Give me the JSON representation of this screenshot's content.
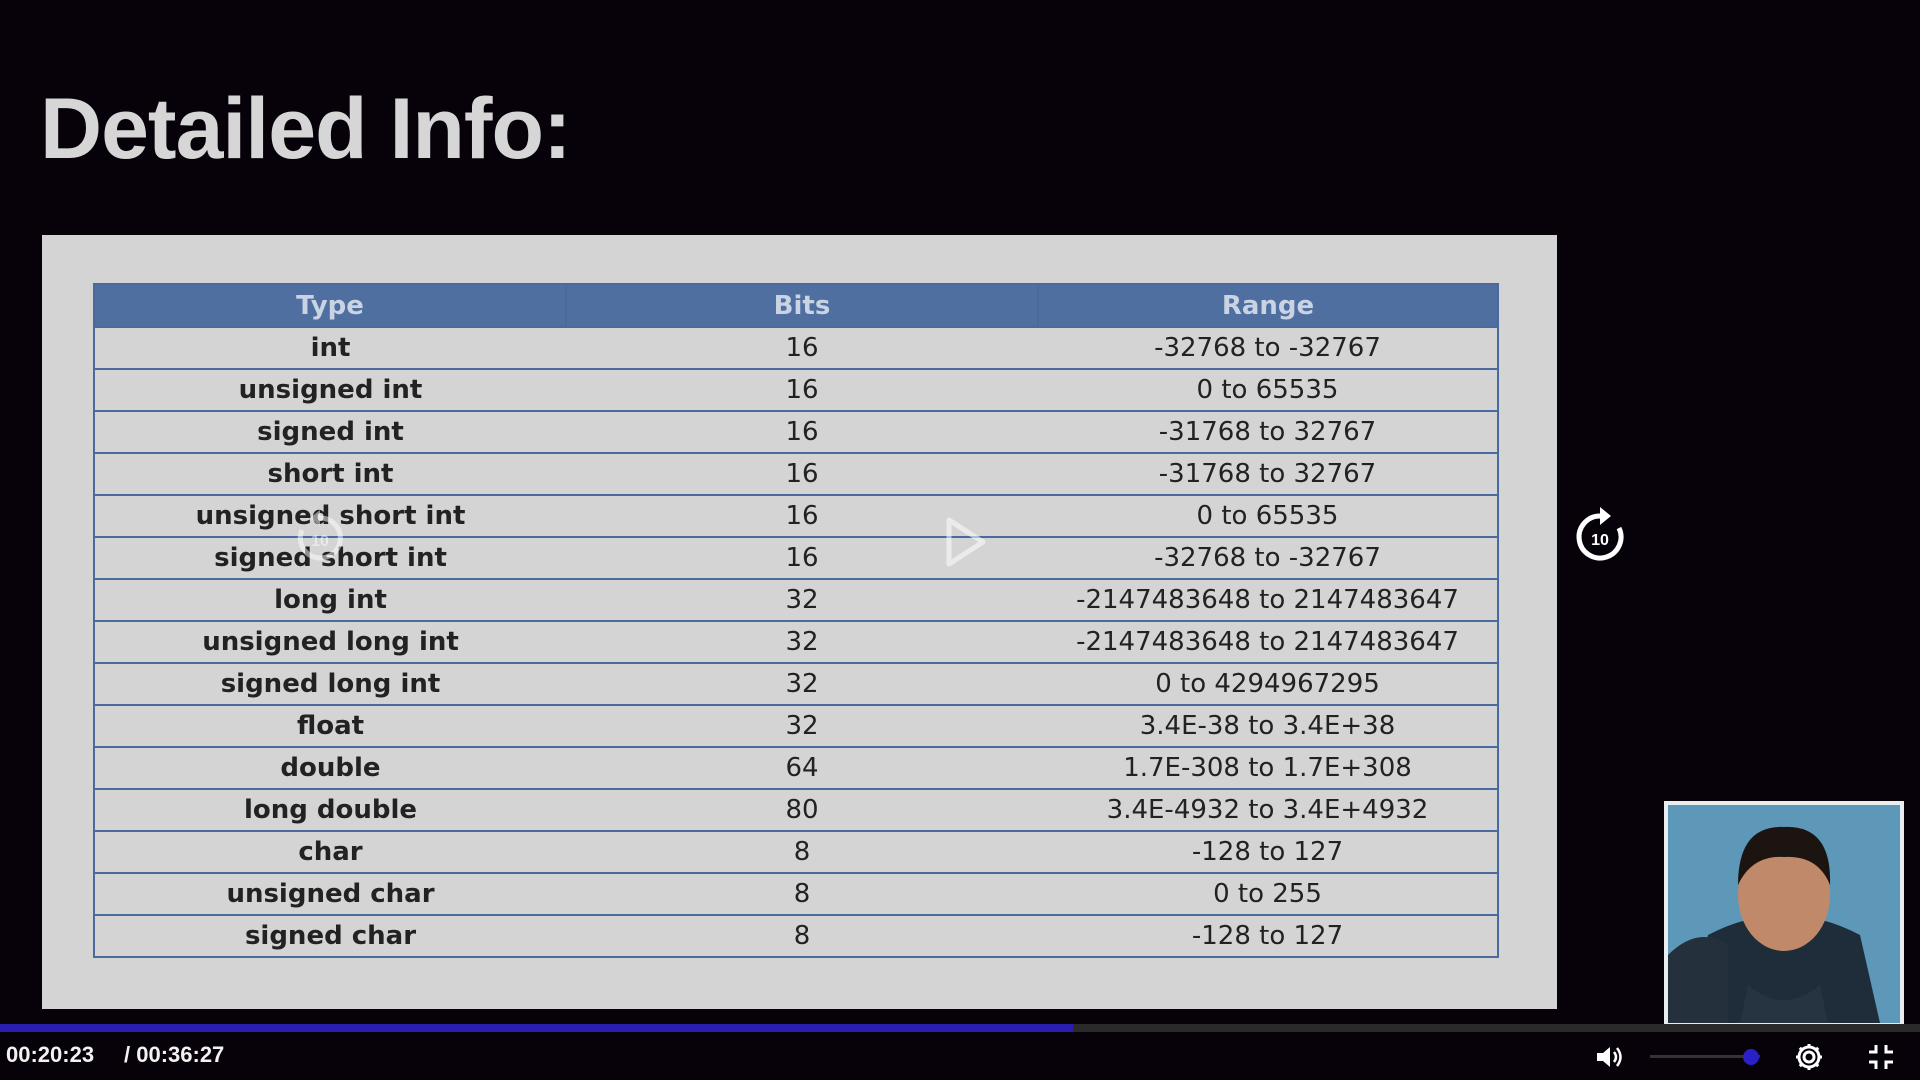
{
  "slide": {
    "title": "Detailed Info:",
    "table": {
      "headers": [
        "Type",
        "Bits",
        "Range"
      ],
      "rows": [
        [
          "int",
          "16",
          "-32768  to -32767"
        ],
        [
          "unsigned int",
          "16",
          "0 to 65535"
        ],
        [
          "signed int",
          "16",
          "-31768  to 32767"
        ],
        [
          "short int",
          "16",
          "-31768  to 32767"
        ],
        [
          "unsigned short int",
          "16",
          "0 to 65535"
        ],
        [
          "signed short int",
          "16",
          "-32768  to -32767"
        ],
        [
          "long int",
          "32",
          "-2147483648  to 2147483647"
        ],
        [
          "unsigned long int",
          "32",
          "-2147483648  to 2147483647"
        ],
        [
          "signed long int",
          "32",
          "0 to 4294967295"
        ],
        [
          "float",
          "32",
          "3.4E-38 to 3.4E+38"
        ],
        [
          "double",
          "64",
          "1.7E-308  to 1.7E+308"
        ],
        [
          "long double",
          "80",
          "3.4E-4932 to 3.4E+4932"
        ],
        [
          "char",
          "8",
          "-128 to 127"
        ],
        [
          "unsigned char",
          "8",
          "0 to 255"
        ],
        [
          "signed char",
          "8",
          "-128 to 127"
        ]
      ]
    }
  },
  "player": {
    "current_time": "00:20:23",
    "total_time": "/ 00:36:27",
    "progress_fraction": 0.5586,
    "volume_fraction": 0.85,
    "skip_back_label": "10",
    "skip_forward_label": "10",
    "accent_color": "#2a1eb0",
    "icons": [
      "rewind-10-icon",
      "play-icon",
      "forward-10-icon",
      "volume-icon",
      "settings-gear-icon",
      "exit-fullscreen-icon"
    ]
  }
}
